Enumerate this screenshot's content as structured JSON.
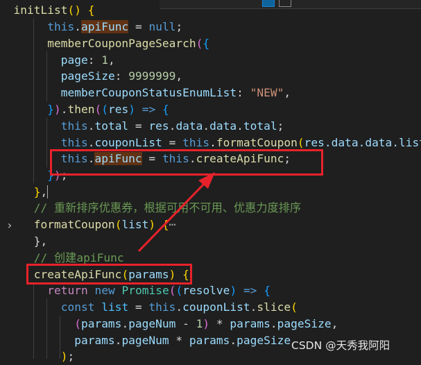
{
  "editor": {
    "lines": {
      "l1_fn": "initList",
      "l2_this": "this",
      "l2_prop": "apiFunc",
      "l2_null": "null",
      "l3_fn": "memberCouponPageSearch",
      "l4_key": "page",
      "l4_val": "1",
      "l5_key": "pageSize",
      "l5_val": "9999999",
      "l6_key": "memberCouponStatusEnumList",
      "l6_val": "\"NEW\"",
      "l7_then": "then",
      "l7_res": "res",
      "l8_this": "this",
      "l8_prop": "total",
      "l8_rhs_res": "res",
      "l8_rhs_data1": "data",
      "l8_rhs_data2": "data",
      "l8_rhs_total": "total",
      "l9_this": "this",
      "l9_prop": "couponList",
      "l9_this2": "this",
      "l9_fn": "formatCoupon",
      "l9_arg": "res.data.data.list",
      "l10_this": "this",
      "l10_prop": "apiFunc",
      "l10_this2": "this",
      "l10_fn": "createApiFunc",
      "l13_comment": "// 重新排序优惠券，根据可用不可用、优惠力度排序",
      "l14_fn": "formatCoupon",
      "l14_arg": "list",
      "l14_fold": "⋯",
      "l16_comment": "// 创建apiFunc",
      "l17_fn": "createApiFunc",
      "l17_arg": "params",
      "l18_return": "return",
      "l18_new": "new",
      "l18_promise": "Promise",
      "l18_arg": "resolve",
      "l19_const": "const",
      "l19_var": "list",
      "l19_this": "this",
      "l19_prop": "couponList",
      "l19_fn": "slice",
      "l20_a": "params",
      "l20_b": "pageNum",
      "l20_c": "1",
      "l20_d": "params",
      "l20_e": "pageSize",
      "l21_a": "params",
      "l21_b": "pageNum",
      "l21_c": "params",
      "l21_d": "pageSize"
    },
    "colors": {
      "annotation_red": "#e8222a",
      "background": "#1f1f1f"
    }
  },
  "watermark": "CSDN @天秀我阿阳"
}
